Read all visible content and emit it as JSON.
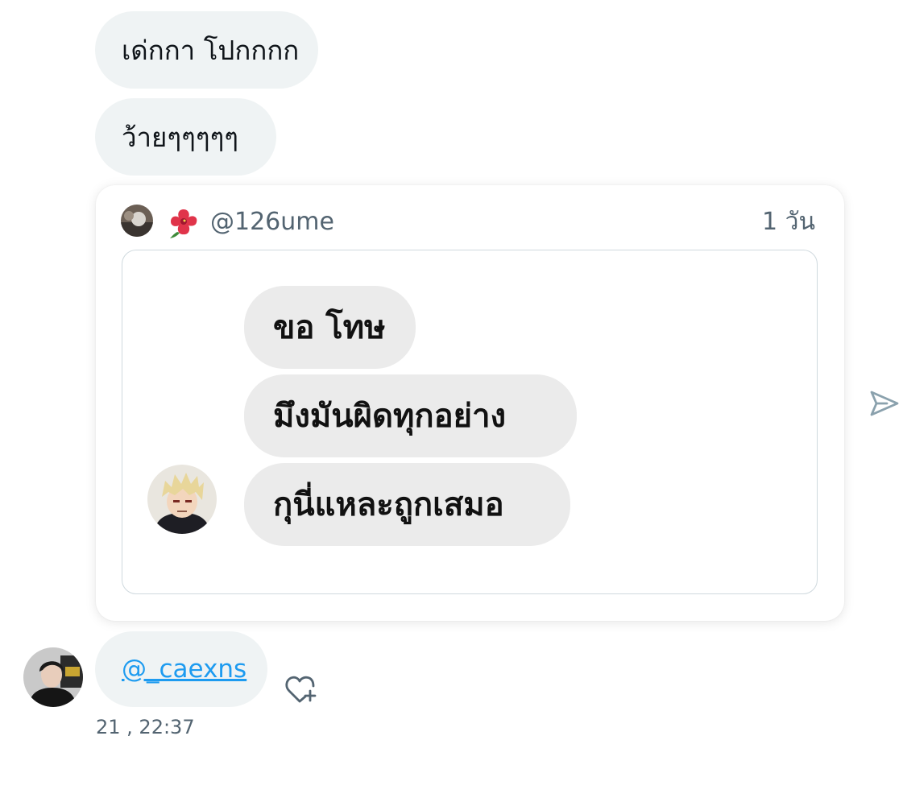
{
  "messages": [
    {
      "text": "เด่กกา โปกกกก"
    },
    {
      "text": "ว้ายๆๆๆๆๆ"
    }
  ],
  "shared_tweet": {
    "author_emoji": "🌺",
    "handle": "@126ume",
    "time": "1 วัน",
    "image_bubbles": [
      "ขอ โทษ",
      "มึงมันผิดทุกอย่าง",
      "กุนี่แหละถูกเสมอ"
    ]
  },
  "mention_message": {
    "mention": "@_caexns",
    "timestamp": "21 , 22:37"
  },
  "colors": {
    "bubble_bg": "#eff3f4",
    "link": "#1d9bf0",
    "muted_text": "#536471",
    "card_border": "#cfd9de"
  },
  "icons": {
    "send": "send-icon",
    "react": "heart-plus-icon"
  }
}
